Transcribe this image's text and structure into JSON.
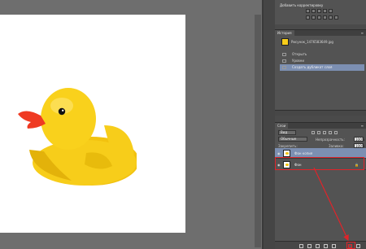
{
  "canvas": {
    "background": "#ffffff",
    "duck_color": "#f7cd1a",
    "beak_color": "#ef3a22"
  },
  "properties_panel": {
    "title": "Добавить корректировку"
  },
  "history_panel": {
    "tab_label": "История",
    "snapshot_label": "Рисунок_1476583649.jpg",
    "items": [
      {
        "label": "Открыть",
        "selected": false
      },
      {
        "label": "Уровни",
        "selected": false
      },
      {
        "label": "Создать дубликат слоя",
        "selected": true
      }
    ]
  },
  "layers_panel": {
    "tab_label": "Слои",
    "kind_label": "Вид",
    "blend_mode": "Обычные",
    "opacity_label": "Непрозрачность:",
    "opacity_value": "100%",
    "lock_label": "Закрепить:",
    "fill_label": "Заливка:",
    "fill_value": "100%",
    "layers": [
      {
        "name": "Фон копия",
        "visible": true,
        "selected": true,
        "locked": false
      },
      {
        "name": "Фон",
        "visible": true,
        "selected": false,
        "locked": true
      }
    ]
  },
  "annotation": {
    "color": "#e0242a"
  }
}
